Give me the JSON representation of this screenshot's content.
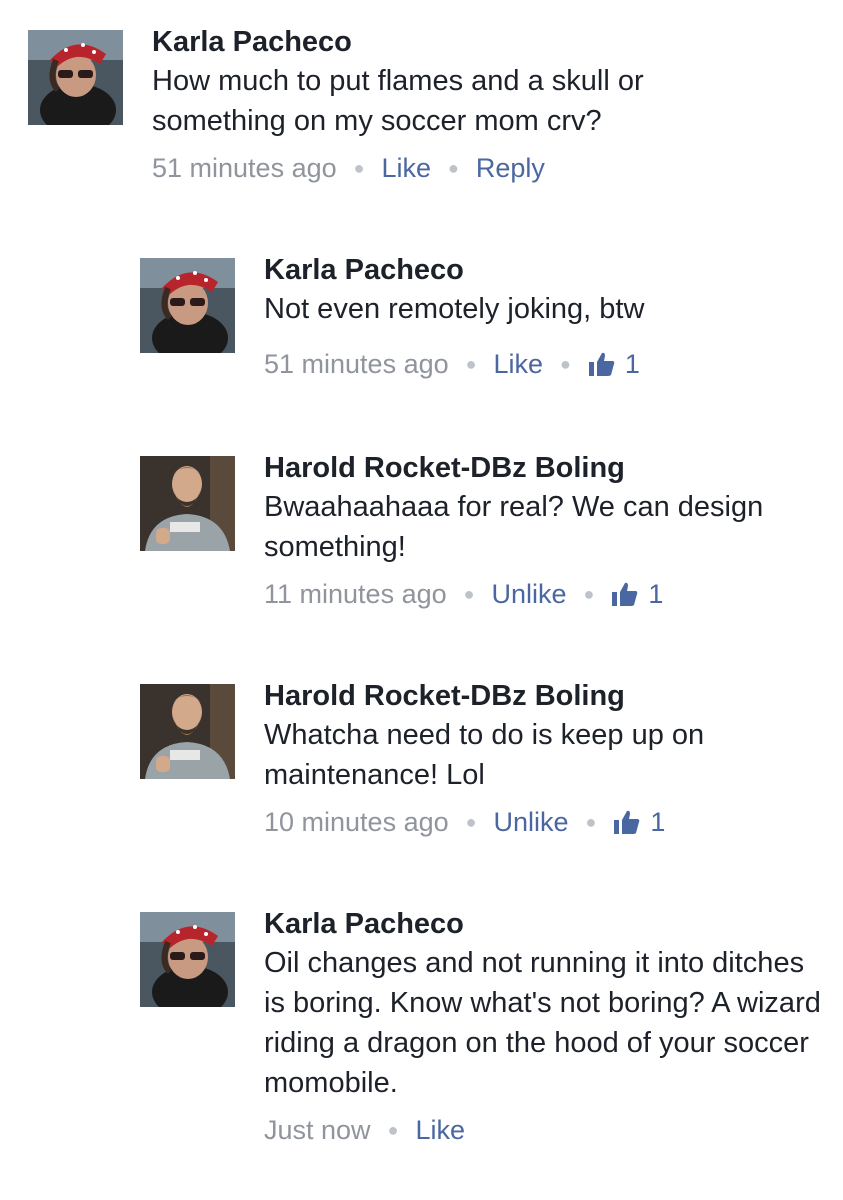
{
  "comments": [
    {
      "author": "Karla Pacheco",
      "text": "How much to put flames and a skull or something on my soccer mom crv?",
      "time": "51 minutes ago",
      "like_label": "Like",
      "reply_label": "Reply"
    },
    {
      "author": "Karla Pacheco",
      "text": "Not even remotely joking, btw",
      "time": "51 minutes ago",
      "like_label": "Like",
      "likes": "1",
      "icon": "thumbs-up-icon"
    },
    {
      "author": "Harold Rocket-DBz Boling",
      "text": "Bwaahaahaaa for real? We can design something!",
      "time": "11 minutes ago",
      "like_label": "Unlike",
      "likes": "1",
      "icon": "thumbs-up-icon"
    },
    {
      "author": "Harold Rocket-DBz Boling",
      "text": "Whatcha need to do is keep up on maintenance! Lol",
      "time": "10 minutes ago",
      "like_label": "Unlike",
      "likes": "1",
      "icon": "thumbs-up-icon"
    },
    {
      "author": "Karla Pacheco",
      "text": "Oil changes and not running it into ditches is boring. Know what's not boring? A wizard riding a dragon on the hood of your soccer momobile.",
      "time": "Just now",
      "like_label": "Like"
    }
  ],
  "colors": {
    "name": "#1d2129",
    "meta": "#90949c",
    "action": "#4b67a1"
  }
}
